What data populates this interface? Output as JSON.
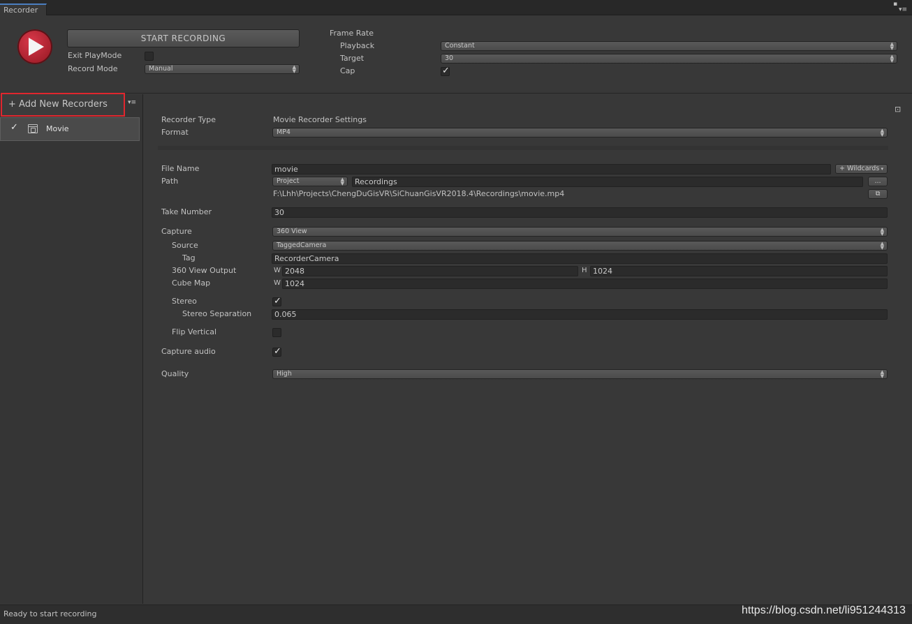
{
  "window": {
    "tab_title": "Recorder",
    "header_icons": [
      "maximize-icon",
      "menu-icon"
    ]
  },
  "toolbar": {
    "start_recording_label": "START RECORDING",
    "exit_playmode_label": "Exit PlayMode",
    "exit_playmode_checked": false,
    "record_mode_label": "Record Mode",
    "record_mode_value": "Manual"
  },
  "frame_rate": {
    "section_label": "Frame Rate",
    "playback_label": "Playback",
    "playback_value": "Constant",
    "target_label": "Target",
    "target_value": "30",
    "cap_label": "Cap",
    "cap_checked": true
  },
  "sidebar": {
    "add_new_label": "+ Add New Recorders",
    "items": [
      {
        "label": "Movie",
        "enabled": true,
        "icon": "clapper-icon"
      }
    ]
  },
  "settings": {
    "recorder_type_label": "Recorder Type",
    "recorder_type_value": "Movie Recorder Settings",
    "format_label": "Format",
    "format_value": "MP4",
    "file_name_label": "File Name",
    "file_name_value": "movie",
    "wildcards_label": "+ Wildcards",
    "path_label": "Path",
    "path_root_value": "Project",
    "path_folder_value": "Recordings",
    "path_browse_label": "...",
    "full_path": "F:\\Lhh\\Projects\\ChengDuGisVR\\SiChuanGisVR2018.4\\Recordings\\movie.mp4",
    "take_number_label": "Take Number",
    "take_number_value": "30",
    "capture_label": "Capture",
    "capture_value": "360 View",
    "source_label": "Source",
    "source_value": "TaggedCamera",
    "tag_label": "Tag",
    "tag_value": "RecorderCamera",
    "view360_label": "360 View Output",
    "view360_w_label": "W",
    "view360_w_value": "2048",
    "view360_h_label": "H",
    "view360_h_value": "1024",
    "cubemap_label": "Cube Map",
    "cubemap_w_label": "W",
    "cubemap_w_value": "1024",
    "stereo_label": "Stereo",
    "stereo_checked": true,
    "stereo_sep_label": "Stereo Separation",
    "stereo_sep_value": "0.065",
    "flip_label": "Flip Vertical",
    "flip_checked": false,
    "capture_audio_label": "Capture audio",
    "capture_audio_checked": true,
    "quality_label": "Quality",
    "quality_value": "High"
  },
  "status": {
    "text": "Ready to start recording"
  },
  "watermark": "https://blog.csdn.net/li951244313",
  "colors": {
    "background": "#383838",
    "record_red": "#c02a36",
    "highlight_border": "#e1262e"
  }
}
